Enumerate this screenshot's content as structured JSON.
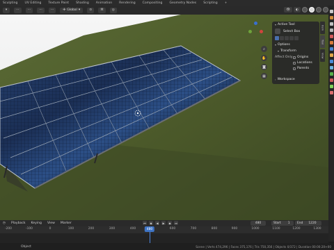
{
  "workspace_tabs": [
    "Sculpting",
    "UV Editing",
    "Texture Paint",
    "Shading",
    "Animation",
    "Rendering",
    "Compositing",
    "Geometry Nodes",
    "Scripting"
  ],
  "viewport": {
    "transform_orientation": "Global",
    "options_label": "Options"
  },
  "n_panel": {
    "active_tool_title": "Active Tool",
    "select_box_label": "Select Box",
    "options_title": "Options",
    "transform_title": "Transform",
    "affect_only_label": "Affect Only",
    "origins_label": "Origins",
    "locations_label": "Locations",
    "parents_label": "Parents",
    "workspace_title": "Workspace",
    "tabs": [
      "Item",
      "Tool",
      "View"
    ]
  },
  "timeline": {
    "playback_label": "Playback",
    "keying_label": "Keying",
    "view_label": "View",
    "marker_label": "Marker",
    "current_frame": "480",
    "start_label": "Start",
    "start_value": "1",
    "end_label": "End",
    "end_value": "1220",
    "ruler_ticks": [
      "-200",
      "-100",
      "0",
      "100",
      "200",
      "300",
      "400",
      "480",
      "600",
      "700",
      "800",
      "900",
      "1000",
      "1100",
      "1200",
      "1300"
    ]
  },
  "status_bar": {
    "object_label": "Object",
    "stats": "Scene | Verts 474,296 | Faces 375,176 | Tris 750,356 | Objects 0/372 | Duration 00:00:20+00"
  },
  "icons": [
    "transform-pivot-icon",
    "snap-icon",
    "proportional-edit-icon",
    "overlay-icon",
    "shading-solid-icon",
    "shading-material-icon",
    "shading-rendered-icon",
    "zoom-icon",
    "pan-icon",
    "camera-icon",
    "perspective-icon",
    "play-icon"
  ],
  "colors": {
    "accent": "#3f75c6",
    "grass": "#4d5a2b",
    "panel": "#1a2c57"
  }
}
